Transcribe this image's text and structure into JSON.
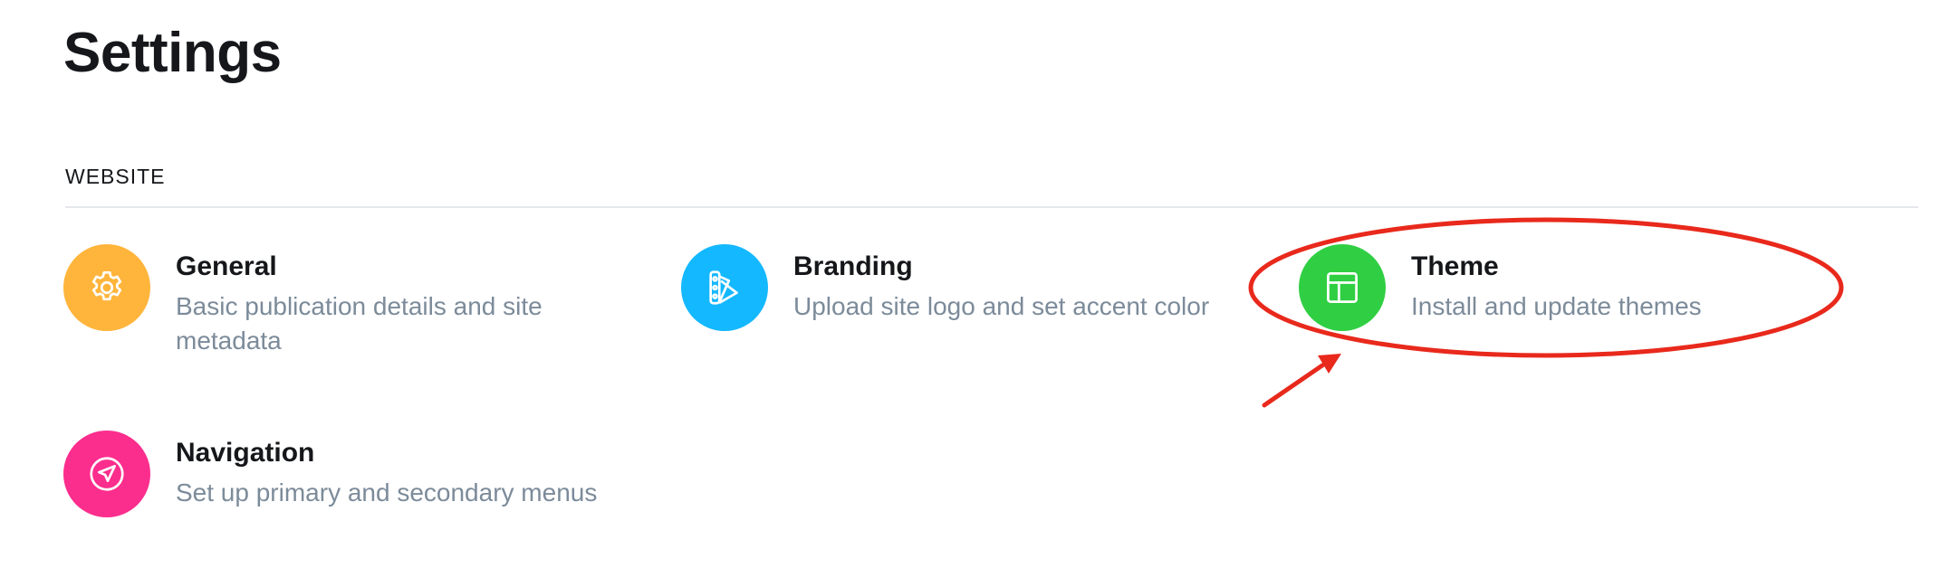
{
  "page": {
    "title": "Settings"
  },
  "section": {
    "header": "WEBSITE"
  },
  "items": [
    {
      "key": "general",
      "title": "General",
      "description": "Basic publication details and site metadata",
      "icon": "gear-icon",
      "color": "#FFB53B"
    },
    {
      "key": "branding",
      "title": "Branding",
      "description": "Upload site logo and set accent color",
      "icon": "swatch-icon",
      "color": "#14B8FF"
    },
    {
      "key": "theme",
      "title": "Theme",
      "description": "Install and update themes",
      "icon": "layout-icon",
      "color": "#30CF43"
    },
    {
      "key": "navigation",
      "title": "Navigation",
      "description": "Set up primary and secondary menus",
      "icon": "send-icon",
      "color": "#FB2D8D"
    }
  ],
  "annotation": {
    "color": "#E8291C",
    "highlighted_item": "theme"
  }
}
